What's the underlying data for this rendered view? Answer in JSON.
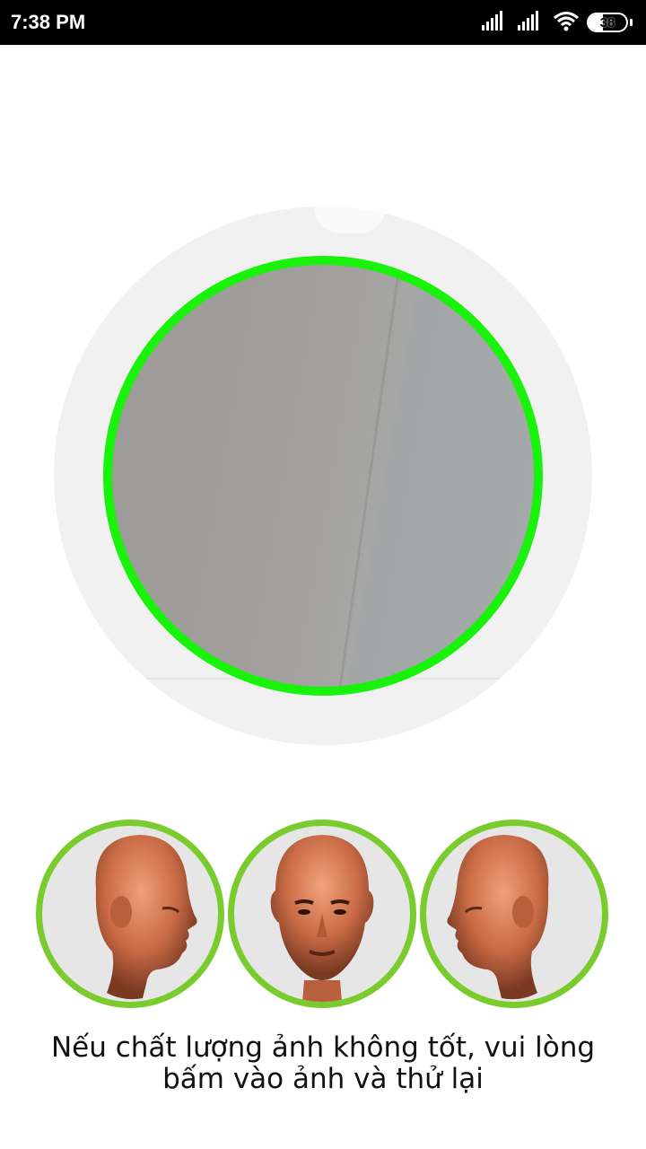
{
  "status_bar": {
    "time": "7:38 PM",
    "battery_level": "38",
    "icons": [
      "signal-icon",
      "signal-icon",
      "wifi-icon",
      "battery-icon"
    ]
  },
  "camera": {
    "ring_color": "#19f20b"
  },
  "poses": [
    {
      "name": "face-left-pose",
      "orientation": "right-facing profile"
    },
    {
      "name": "face-front-pose",
      "orientation": "frontal"
    },
    {
      "name": "face-right-pose",
      "orientation": "left-facing profile"
    }
  ],
  "pose_ring_color": "#7acb2e",
  "instruction": {
    "line1": "Nếu chất lượng ảnh không tốt, vui lòng",
    "line2": "bấm vào ảnh và thử lại"
  }
}
